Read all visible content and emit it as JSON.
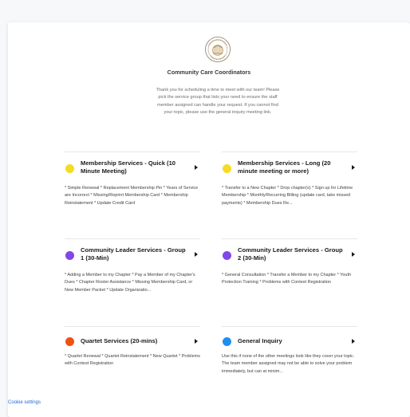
{
  "header": {
    "title": "Community Care Coordinators",
    "intro": "Thank you for scheduling a time to meet with our team! Please pick the service group that lists your need to ensure the staff member assigned can handle your request. If you cannot find your topic, please use the general inquiry meeting link."
  },
  "colors": {
    "yellow": "#f5dc22",
    "purple": "#8247e5",
    "orange": "#f0510f",
    "blue": "#1f8ef1"
  },
  "events": [
    {
      "name": "Membership Services - Quick (10 Minute Meeting)",
      "color": "#f5dc22",
      "description": "* Simple Renewal * Replacement Membership Pin * Years of Service are Incorrect * Missing/Reprint Membership Card * Membership Reinstatement * Update Credit Card"
    },
    {
      "name": "Membership Services - Long (20 minute meeting or more)",
      "color": "#f5dc22",
      "description": "* Transfer to a New Chapter * Drop chapter(s) * Sign up for Lifetime Membership * Monthly/Recurring Billing (update card, take missed payments) * Membership Dues Re..."
    },
    {
      "name": "Community Leader Services - Group 1 (30-Min)",
      "color": "#8247e5",
      "description": "* Adding a Member to my Chapter * Pay a Member of my Chapter's Dues * Chapter Roster Assistance * Missing Membership Card, or New Member Packet * Update Organizatio..."
    },
    {
      "name": "Community Leader Services - Group 2 (30-Min)",
      "color": "#8247e5",
      "description": "* General Consultation * Transfer a Member to my Chapter * Youth Protection Training * Problems with Contest Registration"
    },
    {
      "name": "Quartet Services (20-mins)",
      "color": "#f0510f",
      "description": "* Quartet Renewal * Quartet Reinstatement * New Quartet * Problems with Contest Registration"
    },
    {
      "name": "General Inquiry",
      "color": "#1f8ef1",
      "description": "Use this if none of the other meetings look like they cover your topic. The team member assigned may not be able to solve your problem immediately, but can at minim..."
    }
  ],
  "footer": {
    "cookie_label": "Cookie settings"
  }
}
